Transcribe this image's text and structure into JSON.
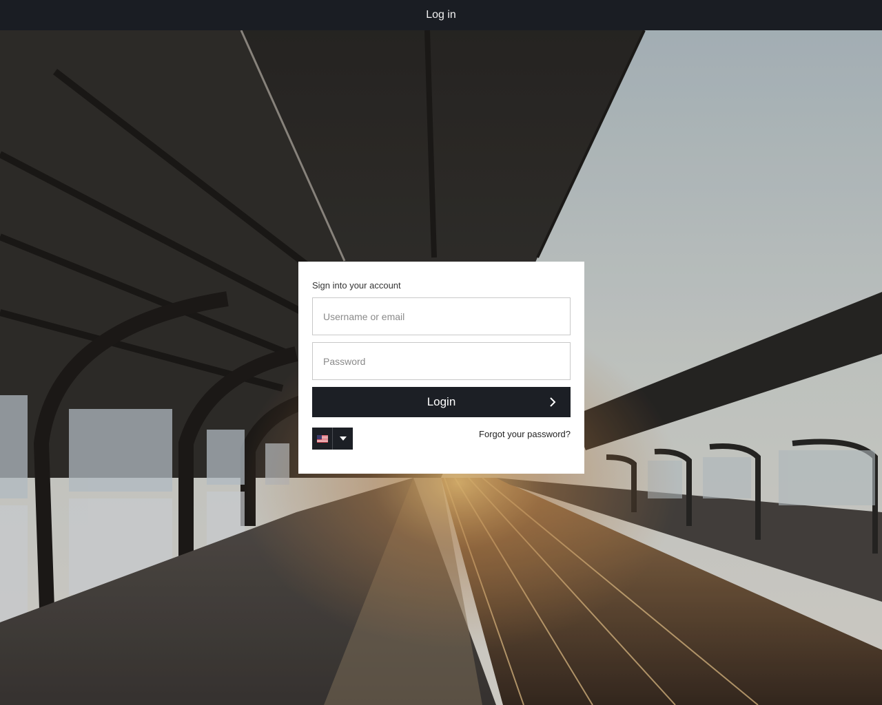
{
  "header": {
    "title": "Log in"
  },
  "login": {
    "heading": "Sign into your account",
    "username_placeholder": "Username or email",
    "password_placeholder": "Password",
    "submit_label": "Login",
    "forgot_label": "Forgot your password?"
  },
  "language": {
    "selected_flag": "us-flag-icon"
  },
  "colors": {
    "topbar": "#1a1d23",
    "button": "#1c1f25",
    "card": "#ffffff"
  }
}
